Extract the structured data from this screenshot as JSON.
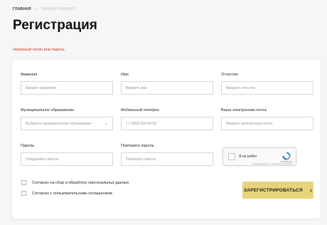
{
  "breadcrumb": {
    "home": "ГЛАВНАЯ",
    "separator": "—",
    "current": "ЛИЧНЫЙ КАБИНЕТ"
  },
  "page_title": "Регистрация",
  "error_message": "Неверный логин или пароль.",
  "form": {
    "last_name": {
      "label": "Фамилия",
      "placeholder": "Введите фамилию"
    },
    "first_name": {
      "label": "Имя",
      "placeholder": "Введите имя"
    },
    "patronymic": {
      "label": "Отчество",
      "placeholder": "Введите отчество"
    },
    "municipality": {
      "label": "Муниципальное образование",
      "placeholder": "Выберите муниципальное образование"
    },
    "phone": {
      "label": "Мобильный телефон",
      "placeholder": "+7 (999) 999-99-99"
    },
    "email": {
      "label": "Ваша электронная почта",
      "placeholder": "Введите электронную почта"
    },
    "password": {
      "label": "Пароль",
      "placeholder": "Придумайте пароль"
    },
    "password_repeat": {
      "label": "Повторите пароль",
      "placeholder": "Повторите пароль"
    }
  },
  "recaptcha": {
    "label": "Я не робот",
    "brand": "reCAPTCHA",
    "terms": "Конфиденциальность - Условия использования"
  },
  "consent_personal_data": "Согласен на сбор и обработку персональных данных",
  "consent_user_agreement": "Согласен с пользовательским соглашением.",
  "submit_label": "ЗАРЕГИСТРИРОВАТЬСЯ",
  "submit_arrow": "›",
  "select_chevron": "⌄"
}
